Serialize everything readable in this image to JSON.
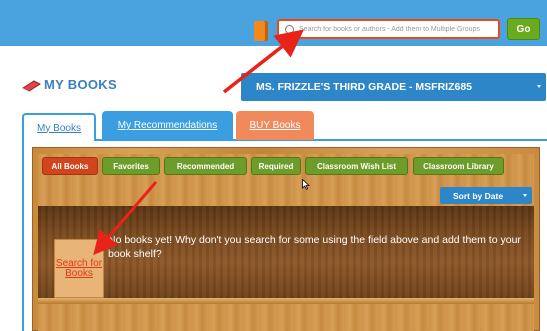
{
  "topbar": {
    "search_placeholder": "Search for books or authors - Add them to Multiple Groups",
    "go_label": "Go"
  },
  "header": {
    "title": "MY BOOKS",
    "class_select": "MS. FRIZZLE'S THIRD GRADE - MSFRIZ685"
  },
  "tabs": [
    {
      "label": "My Books"
    },
    {
      "label": "My Recommendations"
    },
    {
      "label": "BUY Books"
    }
  ],
  "filters": [
    {
      "label": "All Books"
    },
    {
      "label": "Favorites"
    },
    {
      "label": "Recommended"
    },
    {
      "label": "Required"
    },
    {
      "label": "Classroom Wish List"
    },
    {
      "label": "Classroom Library"
    }
  ],
  "sort_label": "Sort by Date",
  "shelf": {
    "empty_message": "No books yet! Why don't you search for some using the field above and add them to your book shelf?",
    "search_card_label": "Search for Books"
  },
  "colors": {
    "topbar": "#4aa3df",
    "accent_blue": "#2c86c8",
    "go_green": "#6aaa1e",
    "active_filter": "#d0451d",
    "arrow_red": "#e8231a"
  }
}
